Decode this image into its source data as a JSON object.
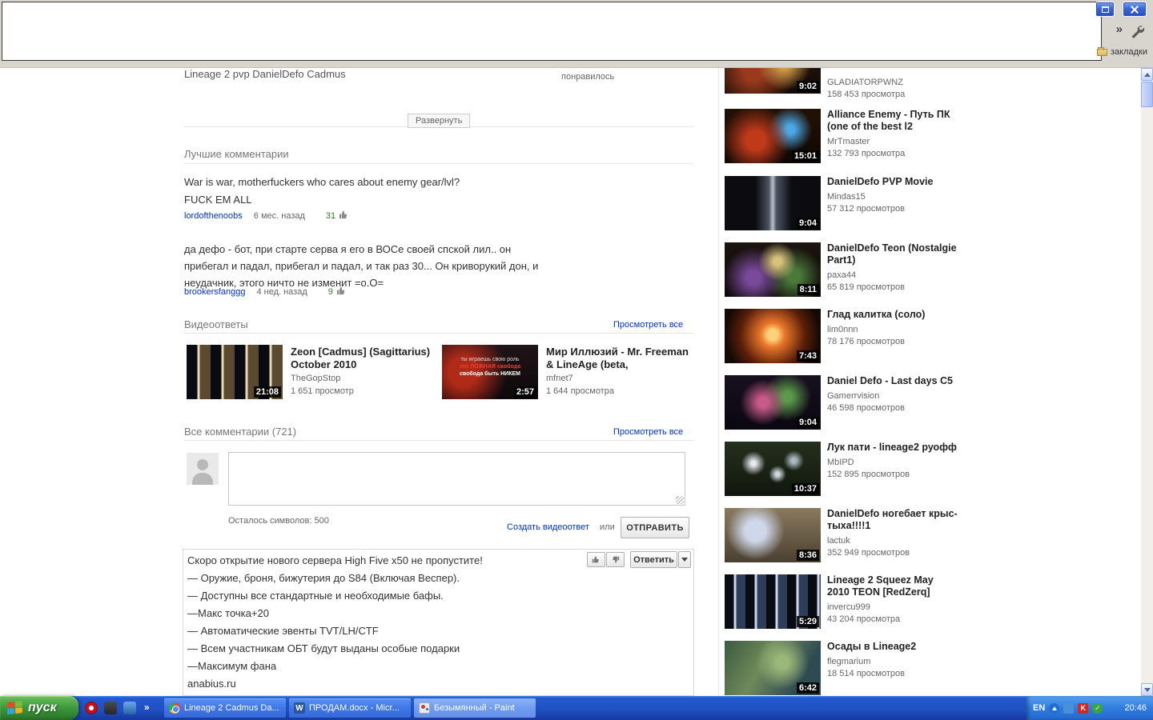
{
  "browser": {
    "overflow_chevron": "»",
    "bookmarks_label": "закладки"
  },
  "video_page": {
    "title": "Lineage 2 pvp DanielDefo Cadmus",
    "liked_label": "понравилось",
    "expand_button": "Развернуть"
  },
  "top_comments": {
    "heading": "Лучшие комментарии",
    "comments": [
      {
        "line1": "War is war, motherfuckers who cares about enemy gear/lvl?",
        "line2": "FUCK EM ALL",
        "author": "lordofthenoobs",
        "time": "6 мес. назад",
        "votes": "31"
      },
      {
        "line1": "да дефо - бот, при старте серва я его в ВОСе своей спской лил.. он",
        "line2": "прибегал и падал, прибегал и падал, и так раз 30... Он криворукий дон, и",
        "line3": "неудачник, этого ничто не изменит =о.О=",
        "author": "brookersfanggg",
        "time": "4 нед. назад",
        "votes": "9"
      }
    ]
  },
  "video_responses": {
    "heading": "Видеоответы",
    "view_all": "Просмотреть все",
    "items": [
      {
        "title": "Zeon [Cadmus] (Sagittarius) October 2010",
        "author": "TheGopStop",
        "views": "1 651 просмотр",
        "duration": "21:08"
      },
      {
        "title": "Мир Иллюзий - Mr. Freeman & LineAge (beta,",
        "author": "mfnet7",
        "views": "1 644 просмотра",
        "duration": "2:57",
        "thumb_text_1": "ты играешь свою роль",
        "thumb_text_2": "это ЛОЖНАЯ свобода",
        "thumb_text_3": "свобода быть НИКЕМ"
      }
    ]
  },
  "all_comments": {
    "heading": "Все комментарии (721)",
    "view_all": "Просмотреть все",
    "chars_remaining": "Осталось символов: 500",
    "create_video_response": "Создать видеоответ",
    "or_label": "или",
    "submit_button": "ОТПРАВИТЬ",
    "comment": {
      "lines": [
        "Скоро открытие нового сервера High Five x50 не пропустите!",
        "— Оружие, броня, бижутерия до S84 (Включая Веспер).",
        "— Доступны все стандартные и необходимые бафы.",
        "—Макс точка+20",
        "— Автоматические эвенты TVT/LH/CTF",
        "— Всем участникам ОБТ будут выданы особые подарки",
        "—Максимум фана",
        "anabius.ru"
      ],
      "reply_button": "Ответить"
    }
  },
  "related_videos": [
    {
      "title": "",
      "author": "GLADIATORPWNZ",
      "views": "158 453 просмотра",
      "duration": "9:02"
    },
    {
      "title": "Alliance Enemy - Путь ПК (one of the best l2",
      "author": "MrTmaster",
      "views": "132 793 просмотра",
      "duration": "15:01"
    },
    {
      "title": "DanielDefo PVP Movie",
      "author": "Mindas15",
      "views": "57 312 просмотров",
      "duration": "9:04"
    },
    {
      "title": "DanielDefo Teon (Nostalgie Part1)",
      "author": "paxa44",
      "views": "65 819 просмотров",
      "duration": "8:11"
    },
    {
      "title": "Глад калитка (соло)",
      "author": "lim0nnn",
      "views": "78 176 просмотров",
      "duration": "7:43"
    },
    {
      "title": "Daniel Defo - Last days C5",
      "author": "Gamerrvision",
      "views": "46 598 просмотров",
      "duration": "9:04"
    },
    {
      "title": "Лук пати - lineage2 руофф",
      "author": "MbIPD",
      "views": "152 895 просмотров",
      "duration": "10:37"
    },
    {
      "title": "DanielDefo ногебает крыс-тыха!!!!1",
      "author": "lactuk",
      "views": "352 949 просмотров",
      "duration": "8:36"
    },
    {
      "title": "Lineage 2 Squeez May 2010 TEON [RedZerq]",
      "author": "invercu999",
      "views": "43 204 просмотра",
      "duration": "5:29"
    },
    {
      "title": "Осады в Lineage2",
      "author": "flegmarium",
      "views": "18 514 просмотров",
      "duration": "6:42"
    }
  ],
  "taskbar": {
    "start_button": "пуск",
    "quick_launch_chevron": "»",
    "tasks": [
      {
        "label": "Lineage 2 Cadmus Da..."
      },
      {
        "label": "ПРОДАМ.docx - Micr..."
      },
      {
        "label": "Безымянный - Paint"
      }
    ],
    "tray": {
      "language": "EN",
      "time": "20:46"
    }
  }
}
